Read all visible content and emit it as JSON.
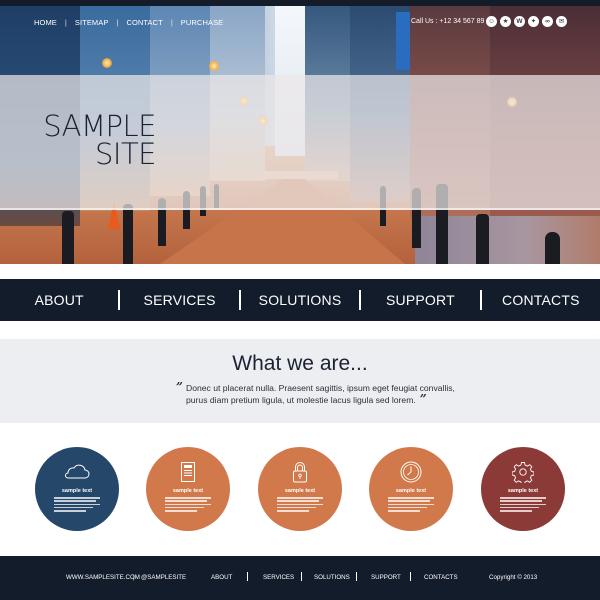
{
  "top_links": [
    {
      "label": "HOME"
    },
    {
      "label": "SITEMAP"
    },
    {
      "label": "CONTACT"
    },
    {
      "label": "PURCHASE"
    }
  ],
  "top_separator": "|",
  "call_us": "Call Us : +12 34 567 89",
  "social_icons": [
    {
      "name": "user-icon",
      "glyph": "☺"
    },
    {
      "name": "star-icon",
      "glyph": "★"
    },
    {
      "name": "wordpress-icon",
      "glyph": "W"
    },
    {
      "name": "share-icon",
      "glyph": "✦"
    },
    {
      "name": "flickr-icon",
      "glyph": "∞"
    },
    {
      "name": "mail-icon",
      "glyph": "✉"
    }
  ],
  "hero": {
    "title_line1": "SAMPLE",
    "title_line2": "SITE"
  },
  "main_nav": [
    {
      "label": "ABOUT"
    },
    {
      "label": "SERVICES"
    },
    {
      "label": "SOLUTIONS"
    },
    {
      "label": "SUPPORT"
    },
    {
      "label": "CONTACTS"
    }
  ],
  "about": {
    "title": "What we are...",
    "quote_open": "”",
    "quote_text": "Donec ut placerat nulla. Praesent sagittis, ipsum eget feugiat convallis, purus diam pretium ligula, ut molestie lacus ligula sed lorem.",
    "quote_close": "”"
  },
  "features": [
    {
      "icon": "cloud-icon",
      "title": "sample text",
      "color": "#24476a"
    },
    {
      "icon": "document-icon",
      "title": "sample text",
      "color": "#d1794a"
    },
    {
      "icon": "lock-icon",
      "title": "sample text",
      "color": "#d1794a"
    },
    {
      "icon": "clock-icon",
      "title": "sample text",
      "color": "#d1794a"
    },
    {
      "icon": "gear-icon",
      "title": "sample text",
      "color": "#8c3a37"
    }
  ],
  "footer": {
    "website": "WWW.SAMPLESITE.COM",
    "separator": "|",
    "handle": "@SAMPLESITE",
    "links": [
      {
        "label": "ABOUT"
      },
      {
        "label": "SERVICES"
      },
      {
        "label": "SOLUTIONS"
      },
      {
        "label": "SUPPORT"
      },
      {
        "label": "CONTACTS"
      }
    ],
    "copyright": "Copyright © 2013"
  },
  "colors": {
    "nav_bg": "#121c2b",
    "footer_bg": "#131c2b",
    "about_bg": "#eceef1",
    "accent_blue": "#24476a",
    "accent_orange": "#d1794a",
    "accent_maroon": "#8c3a37"
  }
}
